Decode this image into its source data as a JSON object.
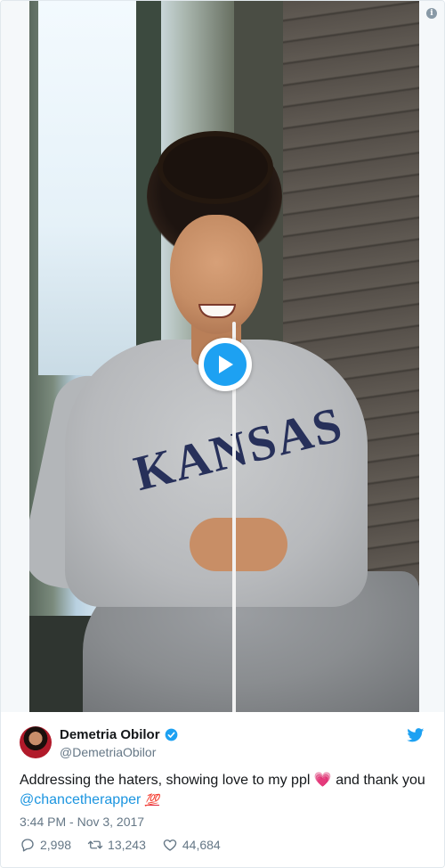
{
  "author": {
    "name": "Demetria Obilor",
    "handle": "@DemetriaObilor",
    "verified": true
  },
  "tweet": {
    "text_before": "Addressing the haters, showing love to my ppl ",
    "heart_emoji": "💗",
    "text_after": " and thank you",
    "mention": "@chancetherapper",
    "hundred_emoji": "💯",
    "timestamp": "3:44 PM - Nov 3, 2017"
  },
  "video": {
    "shirt_text": "KANSAS"
  },
  "stats": {
    "replies": "2,998",
    "retweets": "13,243",
    "likes": "44,684"
  },
  "icons": [
    "info-icon",
    "play-icon",
    "verified-icon",
    "twitter-bird-icon",
    "reply-icon",
    "retweet-icon",
    "like-icon"
  ],
  "colors": {
    "accent": "#1da1f2",
    "link": "#1b95e0",
    "meta": "#657786"
  }
}
